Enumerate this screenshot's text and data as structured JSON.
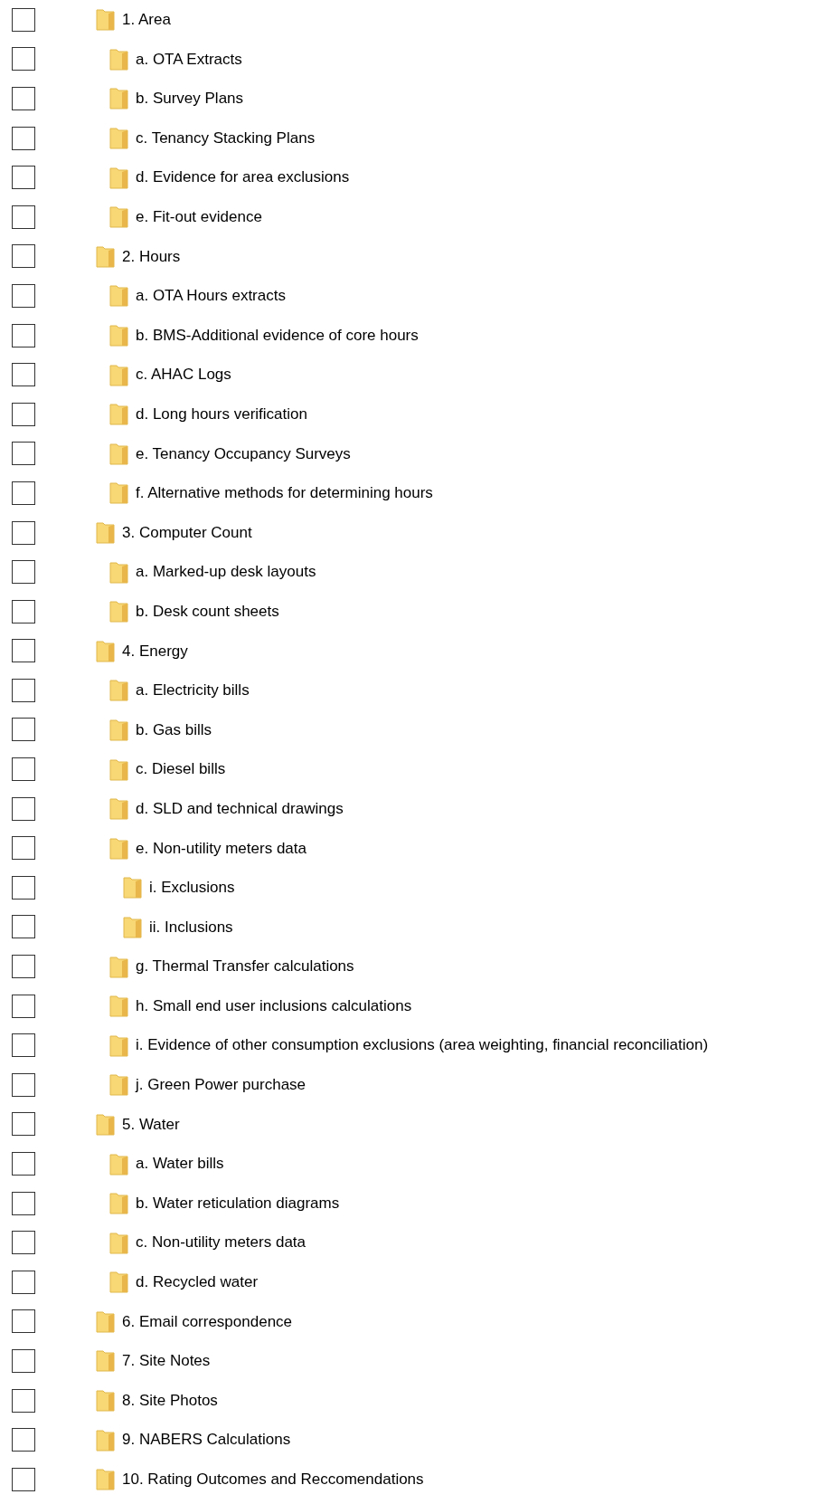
{
  "tree": [
    {
      "label": "1. Area",
      "checked": false,
      "children": [
        {
          "label": "a. OTA Extracts",
          "checked": false
        },
        {
          "label": "b. Survey Plans",
          "checked": false
        },
        {
          "label": "c. Tenancy Stacking Plans",
          "checked": false
        },
        {
          "label": "d. Evidence for area exclusions",
          "checked": false
        },
        {
          "label": "e. Fit-out evidence",
          "checked": false
        }
      ]
    },
    {
      "label": "2. Hours",
      "checked": false,
      "children": [
        {
          "label": "a. OTA Hours extracts",
          "checked": false
        },
        {
          "label": "b. BMS-Additional evidence of core hours",
          "checked": false
        },
        {
          "label": "c. AHAC Logs",
          "checked": false
        },
        {
          "label": "d. Long hours verification",
          "checked": false
        },
        {
          "label": "e. Tenancy Occupancy Surveys",
          "checked": false
        },
        {
          "label": "f. Alternative methods for determining hours",
          "checked": false
        }
      ]
    },
    {
      "label": "3. Computer Count",
      "checked": false,
      "children": [
        {
          "label": "a. Marked-up desk layouts",
          "checked": false
        },
        {
          "label": "b. Desk count sheets",
          "checked": false
        }
      ]
    },
    {
      "label": "4. Energy",
      "checked": false,
      "children": [
        {
          "label": "a. Electricity bills",
          "checked": false
        },
        {
          "label": "b. Gas bills",
          "checked": false
        },
        {
          "label": "c. Diesel bills",
          "checked": false
        },
        {
          "label": "d. SLD and technical drawings",
          "checked": false
        },
        {
          "label": "e. Non-utility meters data",
          "checked": false,
          "children": [
            {
              "label": "i. Exclusions",
              "checked": false
            },
            {
              "label": "ii. Inclusions",
              "checked": false
            }
          ]
        },
        {
          "label": "g. Thermal Transfer calculations",
          "checked": false
        },
        {
          "label": "h. Small end user inclusions calculations",
          "checked": false
        },
        {
          "label": "i. Evidence of other consumption exclusions (area weighting, financial reconciliation)",
          "checked": false
        },
        {
          "label": "j. Green Power purchase",
          "checked": false
        }
      ]
    },
    {
      "label": "5. Water",
      "checked": false,
      "children": [
        {
          "label": "a. Water bills",
          "checked": false
        },
        {
          "label": "b. Water reticulation diagrams",
          "checked": false
        },
        {
          "label": "c. Non-utility meters data",
          "checked": false
        },
        {
          "label": "d. Recycled water",
          "checked": false
        }
      ]
    },
    {
      "label": "6. Email correspondence",
      "checked": false
    },
    {
      "label": "7. Site Notes",
      "checked": false
    },
    {
      "label": "8. Site Photos",
      "checked": false
    },
    {
      "label": "9. NABERS Calculations",
      "checked": false
    },
    {
      "label": "10. Rating Outcomes and Reccomendations",
      "checked": false
    }
  ]
}
